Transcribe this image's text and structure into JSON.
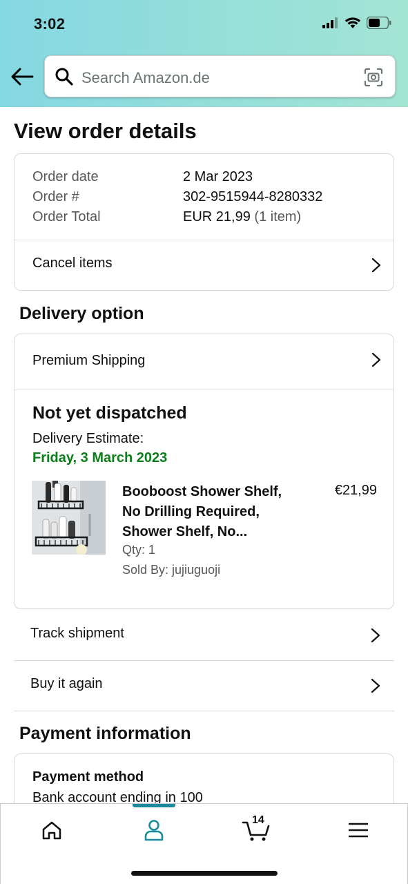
{
  "status_bar": {
    "time": "3:02"
  },
  "search": {
    "placeholder": "Search Amazon.de"
  },
  "page_title": "View order details",
  "order_summary": {
    "date_label": "Order date",
    "date_value": "2 Mar 2023",
    "number_label": "Order #",
    "number_value": "302-9515944-8280332",
    "total_label": "Order Total",
    "total_value": "EUR 21,99",
    "total_items": "(1 item)",
    "cancel_label": "Cancel items"
  },
  "delivery": {
    "section_title": "Delivery option",
    "shipping_label": "Premium Shipping",
    "status": "Not yet dispatched",
    "estimate_label": "Delivery Estimate:",
    "estimate_date": "Friday, 3 March 2023",
    "estimate_color": "#0b7d1a",
    "item": {
      "title": "Booboost Shower Shelf, No Drilling Required, Shower Shelf, No...",
      "price": "€21,99",
      "qty": "Qty: 1",
      "sold_by": "Sold By: jujiuguoji"
    }
  },
  "actions": {
    "track": "Track shipment",
    "buy_again": "Buy it again"
  },
  "payment": {
    "section_title": "Payment information",
    "method_title": "Payment method",
    "method_value": "Bank account ending in 100"
  },
  "bottom_nav": {
    "cart_count": "14",
    "tabs": [
      "home-icon",
      "account-icon",
      "cart-icon",
      "menu-icon"
    ],
    "active_color": "#1a8a9c"
  }
}
